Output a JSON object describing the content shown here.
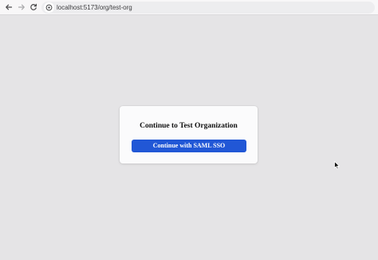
{
  "browser": {
    "url": "localhost:5173/org/test-org",
    "icons": {
      "back": "arrow-left-icon",
      "forward": "arrow-right-icon",
      "reload": "reload-icon",
      "site_info": "site-info-icon"
    }
  },
  "card": {
    "title": "Continue to Test Organization",
    "button_label": "Continue with SAML SSO"
  },
  "colors": {
    "page_background": "#e5e4e6",
    "card_background": "#fbfbfc",
    "button_background": "#2157d6",
    "button_text": "#ffffff"
  }
}
